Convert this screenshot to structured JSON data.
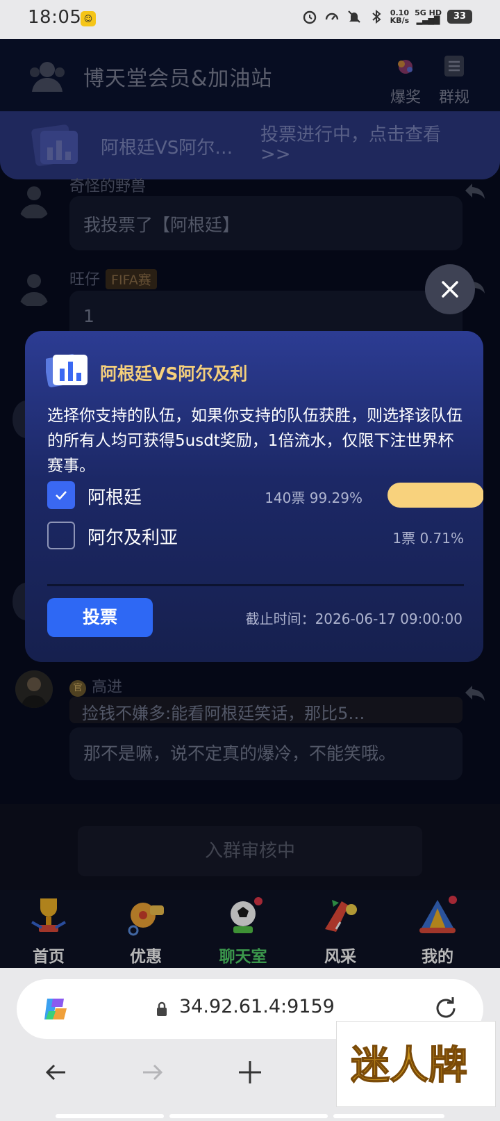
{
  "status_bar": {
    "time": "18:05",
    "net_speed": "0.10",
    "net_unit": "KB/s",
    "signal": "5G HD",
    "battery": "33"
  },
  "header": {
    "title": "博天堂会员&加油站",
    "btn_prize": "爆奖",
    "btn_rules": "群规"
  },
  "vote_banner": {
    "title": "阿根廷VS阿尔…",
    "status": "投票进行中，点击查看>>"
  },
  "messages": [
    {
      "name": "奇怪的野兽",
      "text": "我投票了【阿根廷】"
    },
    {
      "name": "旺仔",
      "tag": "FIFA赛",
      "text": "1"
    },
    {
      "name": "高进",
      "badge": "官",
      "quote": "捡钱不嫌多:能看阿根廷笑话，那比5…",
      "text": "那不是嘛，说不定真的爆冷，不能笑哦。"
    }
  ],
  "join_status": "入群审核中",
  "tabbar": [
    {
      "label": "首页",
      "icon": "trophy-icon"
    },
    {
      "label": "优惠",
      "icon": "whistle-icon"
    },
    {
      "label": "聊天室",
      "icon": "soccer-ball-icon",
      "active": true
    },
    {
      "label": "风采",
      "icon": "horn-icon"
    },
    {
      "label": "我的",
      "icon": "jester-hat-icon"
    }
  ],
  "poll": {
    "title": "阿根廷VS阿尔及利",
    "description": "选择你支持的队伍，如果你支持的队伍获胜，则选择该队伍的所有人均可获得5usdt奖励，1倍流水，仅限下注世界杯赛事。",
    "options": [
      {
        "label": "阿根廷",
        "votes": "140票",
        "percent": "99.29%",
        "checked": true,
        "share": 0.9929
      },
      {
        "label": "阿尔及利亚",
        "votes": "1票",
        "percent": "0.71%",
        "checked": false,
        "share": 0.0071
      }
    ],
    "vote_button": "投票",
    "deadline": "截止时间：2026-06-17 09:00:00"
  },
  "browser": {
    "url": "34.92.61.4:9159"
  },
  "watermark": "迷人牌",
  "colors": {
    "accent_gold": "#f4cf7c",
    "vote_blue": "#2e68f4",
    "active_tab": "#53d36a"
  }
}
